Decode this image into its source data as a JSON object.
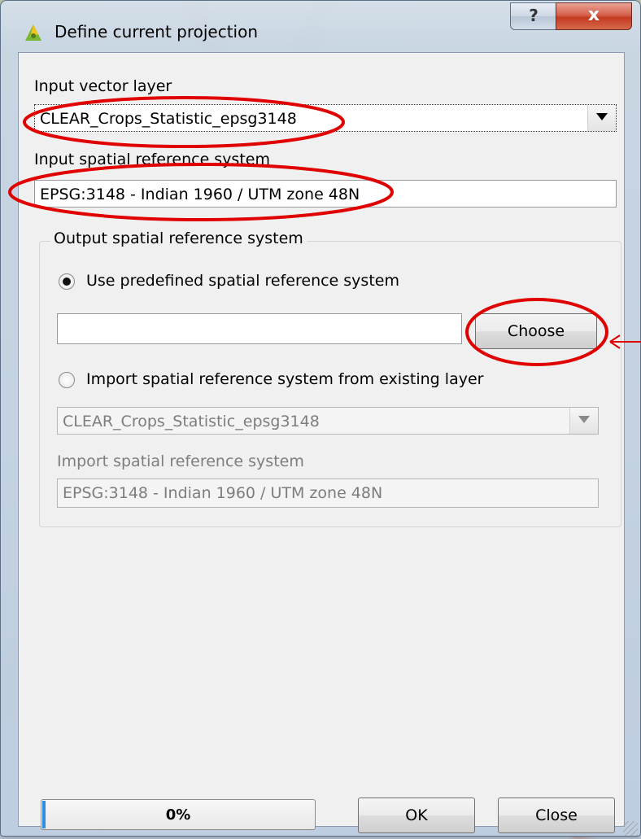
{
  "window": {
    "title": "Define current projection",
    "help_glyph": "?",
    "close_glyph": "x"
  },
  "input_layer": {
    "label": "Input vector layer",
    "selected": "CLEAR_Crops_Statistic_epsg3148"
  },
  "input_srs": {
    "label": "Input spatial reference system",
    "value": "EPSG:3148 - Indian 1960 / UTM zone 48N"
  },
  "output_srs": {
    "group_title": "Output spatial reference system",
    "use_predefined_label": "Use predefined spatial reference system",
    "predefined_value": "",
    "choose_label": "Choose",
    "import_label": "Import spatial reference system from existing layer",
    "import_layer_selected": "CLEAR_Crops_Statistic_epsg3148",
    "import_srs_label": "Import spatial reference system",
    "import_srs_value": "EPSG:3148 - Indian 1960 / UTM zone 48N"
  },
  "footer": {
    "progress_text": "0%",
    "progress_value": 0,
    "ok_label": "OK",
    "close_label": "Close"
  },
  "colors": {
    "annotation": "#e00000",
    "progress_fill": "#2d8de6"
  }
}
